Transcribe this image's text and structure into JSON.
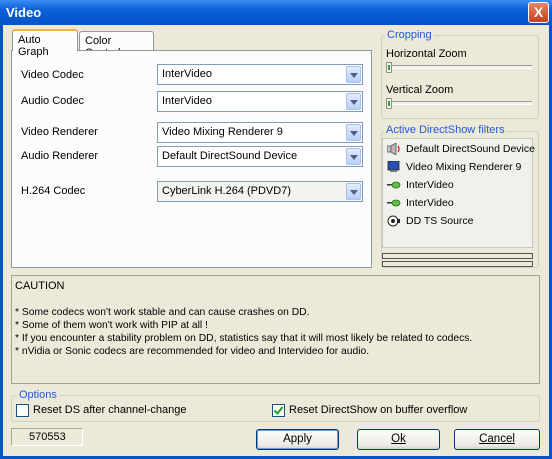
{
  "window": {
    "title": "Video",
    "close_symbol": "X"
  },
  "tabs": [
    {
      "label": "Auto Graph",
      "active": true
    },
    {
      "label": "Color Controls",
      "active": false
    }
  ],
  "codecs": {
    "video_codec": {
      "label": "Video Codec",
      "value": "InterVideo"
    },
    "audio_codec": {
      "label": "Audio Codec",
      "value": "InterVideo"
    },
    "video_renderer": {
      "label": "Video Renderer",
      "value": "Video Mixing Renderer 9"
    },
    "audio_renderer": {
      "label": "Audio Renderer",
      "value": "Default DirectSound Device"
    },
    "h264_codec": {
      "label": "H.264 Codec",
      "value": "CyberLink H.264 (PDVD7)"
    }
  },
  "cropping": {
    "title": "Cropping",
    "horizontal_label": "Horizontal Zoom",
    "horizontal_value": 0,
    "vertical_label": "Vertical Zoom",
    "vertical_value": 0
  },
  "filters": {
    "title": "Active DirectShow filters",
    "items": [
      {
        "label": "Default DirectSound Device",
        "icon": "speaker-icon"
      },
      {
        "label": "Video Mixing Renderer 9",
        "icon": "monitor-icon"
      },
      {
        "label": "InterVideo",
        "icon": "codec-icon"
      },
      {
        "label": "InterVideo",
        "icon": "codec-icon"
      },
      {
        "label": "DD TS Source",
        "icon": "source-icon"
      }
    ]
  },
  "caution": {
    "title": "CAUTION",
    "lines": [
      "*  Some codecs won't work stable and can cause crashes on DD.",
      "*  Some of them won't work with PIP at all !",
      "*  If you encounter a stability problem on DD, statistics say that it will most likely be related to codecs.",
      "*  nVidia or Sonic codecs are recommended for video and Intervideo for audio."
    ]
  },
  "options": {
    "title": "Options",
    "reset_ds_label": "Reset DS after channel-change",
    "reset_ds_checked": false,
    "reset_overflow_label": "Reset DirectShow on buffer overflow",
    "reset_overflow_checked": true
  },
  "status": {
    "value": "570553"
  },
  "buttons": {
    "apply": "Apply",
    "ok": "Ok",
    "cancel": "Cancel"
  }
}
